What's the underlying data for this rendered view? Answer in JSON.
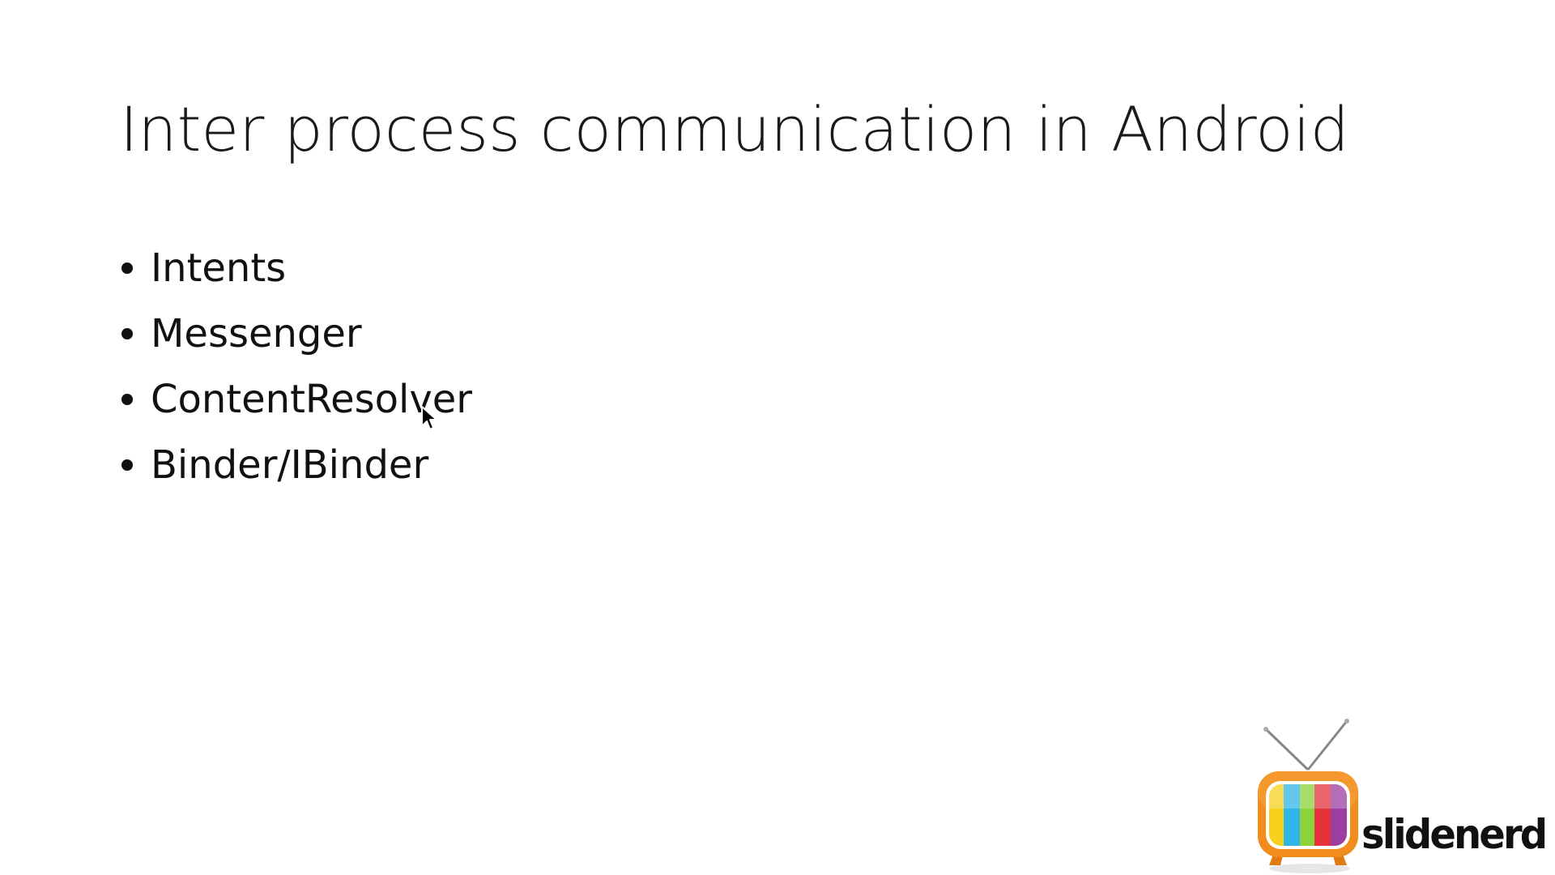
{
  "slide": {
    "title": "Inter process communication in Android",
    "bullets": [
      {
        "label": "Intents"
      },
      {
        "label": "Messenger"
      },
      {
        "label": "ContentResolver"
      },
      {
        "label": "Binder/IBinder"
      }
    ]
  },
  "logo": {
    "text": "slidenerd",
    "icon": "retro-tv-icon"
  },
  "cursor": {
    "icon": "mouse-pointer-icon"
  },
  "colors": {
    "background": "#ffffff",
    "text": "#111111",
    "tv_orange": "#f28c1c",
    "tv_stripes": [
      "#f6d11d",
      "#2fb5e8",
      "#8bd23b",
      "#e3323c",
      "#9b3fa0"
    ]
  }
}
